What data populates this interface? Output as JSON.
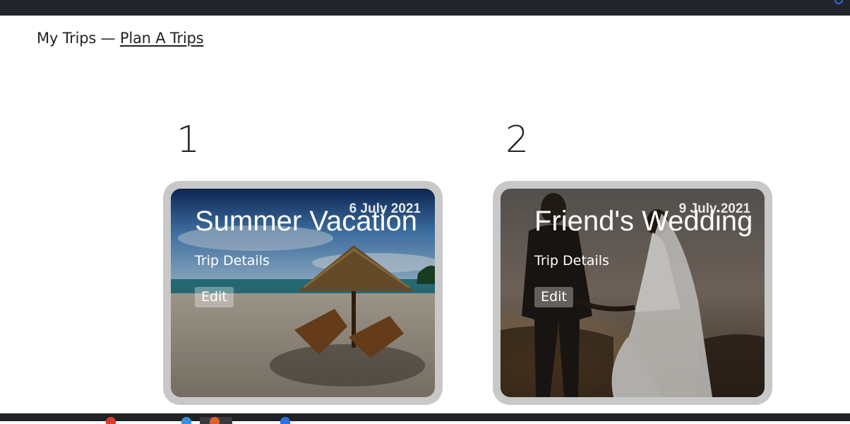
{
  "header": {
    "title": "My Trips",
    "separator": "—",
    "link_label": "Plan A Trips"
  },
  "trips": [
    {
      "number": "1",
      "name": "Summer Vacation",
      "date": "6 July 2021",
      "details_label": "Trip Details",
      "edit_label": "Edit"
    },
    {
      "number": "2",
      "name": "Friend's Wedding",
      "date": "9 July 2021",
      "details_label": "Trip Details",
      "edit_label": "Edit"
    }
  ],
  "colors": {
    "top_bar": "#21252b",
    "taskbar": "#202124",
    "card_frame": "#c8c8c8"
  }
}
